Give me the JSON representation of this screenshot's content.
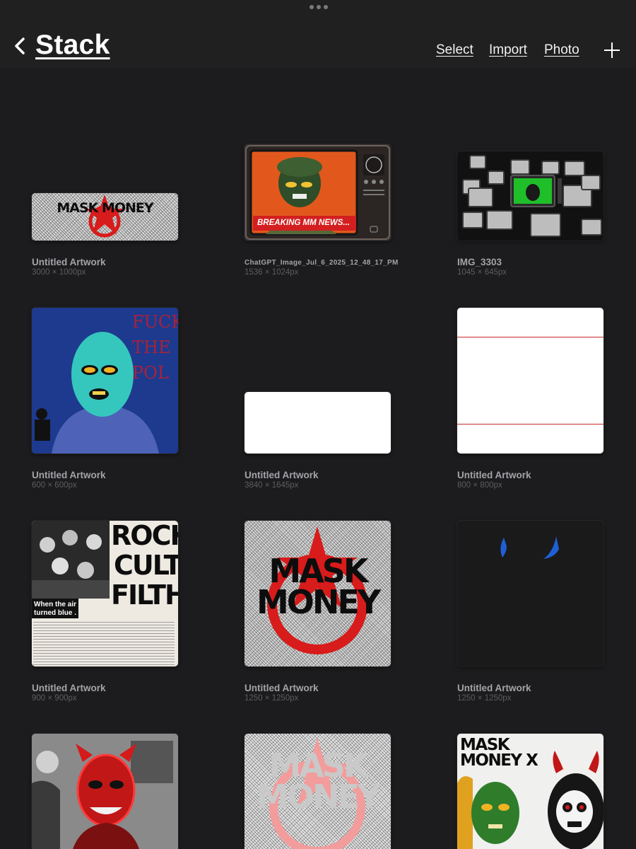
{
  "header": {
    "title": "Stack",
    "links": {
      "select": "Select",
      "import": "Import",
      "photo": "Photo"
    }
  },
  "artworks": [
    {
      "name": "Untitled Artwork",
      "dims": "3000 × 1000px",
      "thumb_text": "MASK MONEY"
    },
    {
      "name": "ChatGPT_Image_Jul_6_2025_12_48_17_PM",
      "dims": "1536 × 1024px",
      "thumb_text": "BREAKING MM NEWS..."
    },
    {
      "name": "IMG_3303",
      "dims": "1045 × 645px"
    },
    {
      "name": "Untitled Artwork",
      "dims": "600 × 600px",
      "thumb_text": "FUCK THE POL"
    },
    {
      "name": "Untitled Artwork",
      "dims": "3840 × 1645px"
    },
    {
      "name": "Untitled Artwork",
      "dims": "800 × 800px"
    },
    {
      "name": "Untitled Artwork",
      "dims": "900 × 900px",
      "thumb_text": [
        "ROCK",
        "CULT",
        "FILTH",
        "When the air turned blue . ."
      ]
    },
    {
      "name": "Untitled Artwork",
      "dims": "1250 × 1250px",
      "thumb_text": "MASK MONEY"
    },
    {
      "name": "Untitled Artwork",
      "dims": "1250 × 1250px"
    },
    {
      "name": "",
      "dims": ""
    },
    {
      "name": "",
      "dims": "",
      "thumb_text": "MASK MONEY"
    },
    {
      "name": "",
      "dims": "",
      "thumb_text": "MASK MONEY X"
    }
  ],
  "colors": {
    "background": "#1c1c1e",
    "accent_red": "#d81b1b",
    "caption": "#a3a3a8",
    "dims": "#5d5d62"
  }
}
